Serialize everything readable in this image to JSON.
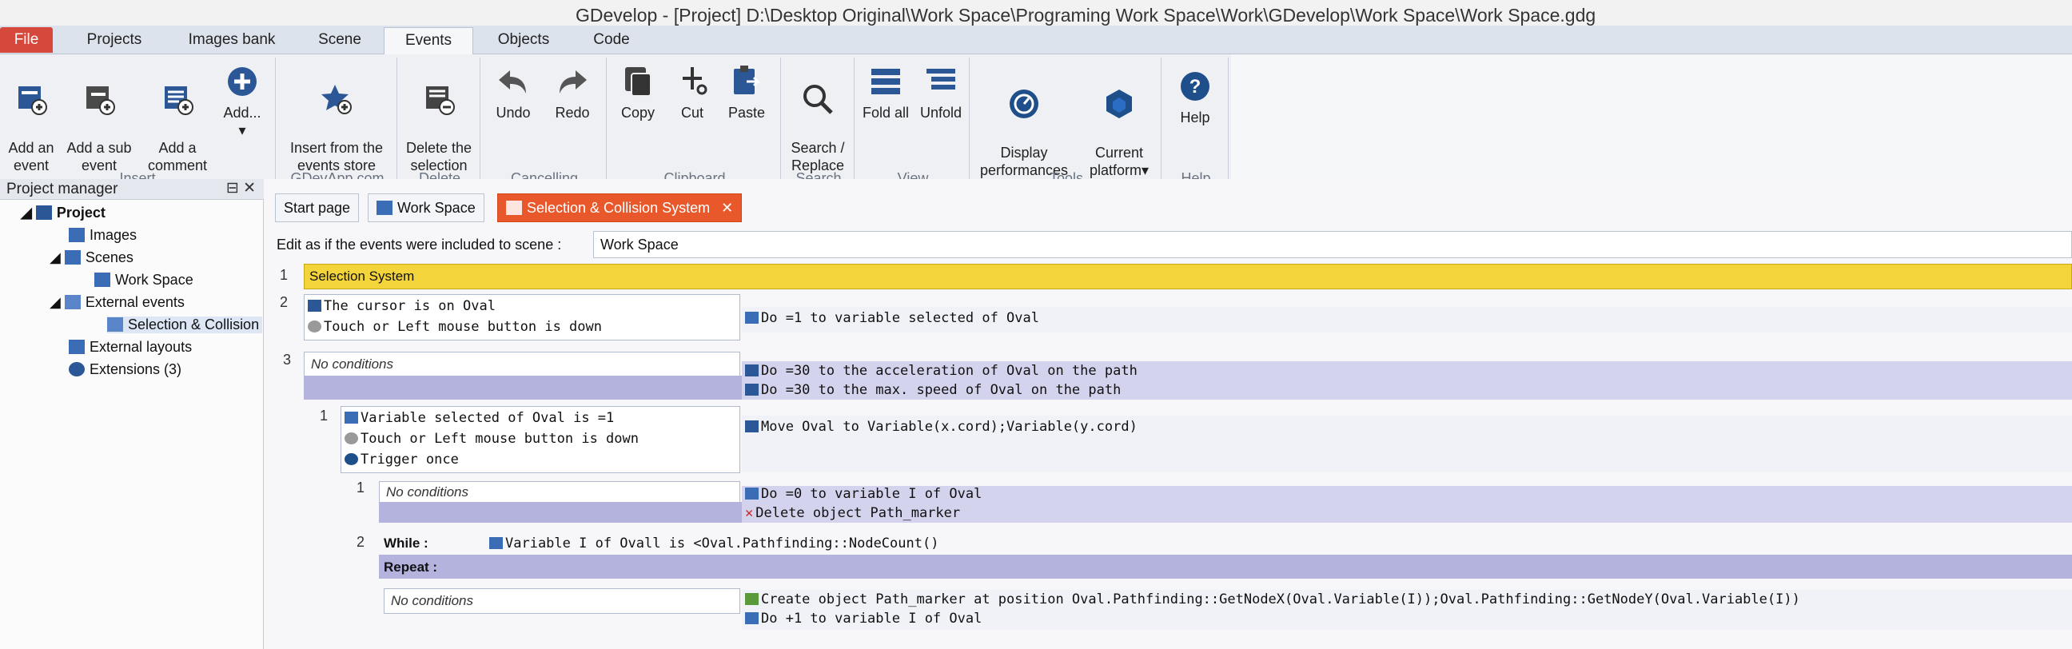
{
  "window": {
    "title": "GDevelop - [Project] D:\\Desktop Original\\Work Space\\Programing Work Space\\Work\\GDevelop\\Work Space\\Work Space.gdg"
  },
  "ribbon_tabs": [
    "File",
    "Projects",
    "Images bank",
    "Scene",
    "Events",
    "Objects",
    "Code"
  ],
  "ribbon": {
    "insert": {
      "label": "Insert",
      "add_event": "Add an\nevent",
      "add_sub_event": "Add a sub\nevent",
      "add_comment": "Add a\ncomment",
      "add_more": "Add...",
      "add_more_arrow": "▾"
    },
    "gdevapp": {
      "label": "GDevApp.com",
      "insert_store": "Insert from the\nevents store"
    },
    "delete": {
      "label": "Delete",
      "delete_selection": "Delete the\nselection"
    },
    "cancelling": {
      "label": "Cancelling",
      "undo": "Undo",
      "redo": "Redo"
    },
    "clipboard": {
      "label": "Clipboard",
      "copy": "Copy",
      "cut": "Cut",
      "paste": "Paste"
    },
    "search": {
      "label": "Search",
      "search_replace": "Search /\nReplace"
    },
    "view": {
      "label": "View",
      "fold_all": "Fold all",
      "unfold": "Unfold"
    },
    "tools": {
      "label": "Tools",
      "display_perf": "Display\nperformances",
      "current_platform": "Current\nplatform▾"
    },
    "help": {
      "label": "Help",
      "help": "Help"
    }
  },
  "project_manager": {
    "title": "Project manager",
    "controls": "⊟ ✕",
    "tree": {
      "project": "Project",
      "images": "Images",
      "scenes": "Scenes",
      "work_space": "Work Space",
      "external_events": "External events",
      "selection_collision": "Selection & Collision",
      "external_layouts": "External layouts",
      "extensions": "Extensions (3)"
    }
  },
  "editor": {
    "tabs": {
      "start": "Start page",
      "workspace": "Work Space",
      "selection": "Selection & Collision System"
    },
    "edit_as_label": "Edit as if the events were included to scene :",
    "scene_value": "Work Space",
    "events": {
      "e1_num": "1",
      "e1_comment": "Selection System",
      "e2_num": "2",
      "e2_cond1": "The cursor is on Oval",
      "e2_cond2": "Touch or Left mouse button is down",
      "e2_act1": "Do =1 to variable selected of Oval",
      "e3_num": "3",
      "e3_nocond": "No conditions",
      "e3_act1": "Do =30 to the acceleration of Oval on the path",
      "e3_act2": "Do =30 to the max. speed of Oval on the path",
      "s1_num": "1",
      "s1_cond1": "Variable selected of Oval is =1",
      "s1_cond2": "Touch or Left mouse button is down",
      "s1_cond3": "Trigger once",
      "s1_act1": "Move Oval to Variable(x.cord);Variable(y.cord)",
      "ss1_num": "1",
      "ss1_nocond": "No conditions",
      "ss1_act1": "Do =0 to variable I of Oval",
      "ss1_act2": "Delete object Path_marker",
      "ss2_num": "2",
      "ss2_while": "While :",
      "ss2_while_cond": "Variable I of Ovall is <Oval.Pathfinding::NodeCount()",
      "ss2_repeat": "Repeat :",
      "ss2_nocond": "No conditions",
      "ss2_act1": "Create object Path_marker at position Oval.Pathfinding::GetNodeX(Oval.Variable(I));Oval.Pathfinding::GetNodeY(Oval.Variable(I))",
      "ss2_act2": "Do +1 to variable I of Oval"
    }
  },
  "colors": {
    "file_tab": "#d6473c",
    "active_editor_tab": "#e8582b",
    "comment_yellow": "#f3d43b",
    "subevent_band": "#b3b3de"
  }
}
